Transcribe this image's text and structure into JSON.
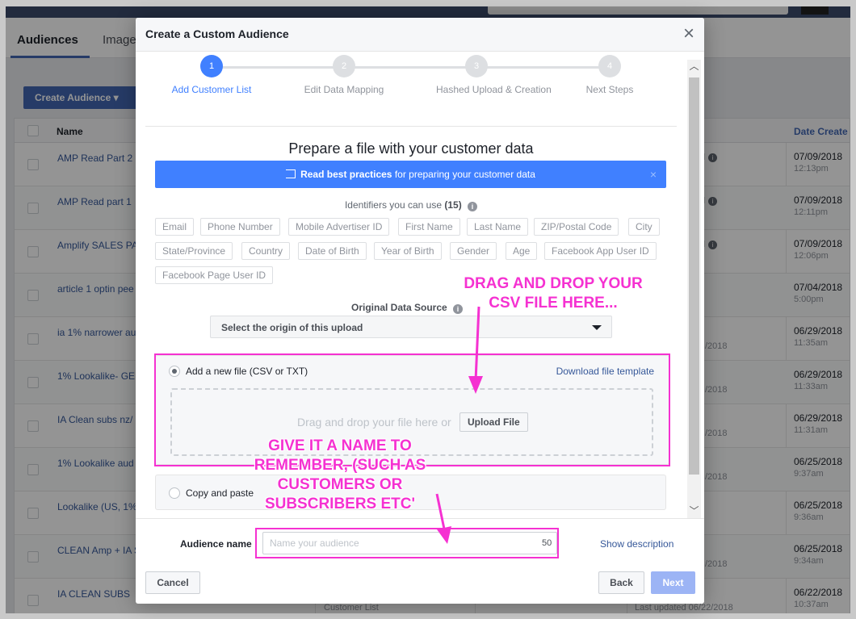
{
  "background": {
    "tabs": [
      "Audiences",
      "Image"
    ],
    "create_button": "Create Audience",
    "col_name": "Name",
    "col_date": "Date Create",
    "rows": [
      {
        "name": "AMP Read Part 2",
        "mid": "",
        "info": "ll",
        "date": "07/09/2018",
        "time": "12:13pm"
      },
      {
        "name": "AMP Read part 1",
        "mid": "",
        "info": "ll",
        "date": "07/09/2018",
        "time": "12:11pm"
      },
      {
        "name": "Amplify SALES PA",
        "mid": "",
        "info": "ll",
        "date": "07/09/2018",
        "time": "12:06pm"
      },
      {
        "name": "article 1 optin pee",
        "mid": "",
        "info": "",
        "date": "07/04/2018",
        "time": "5:00pm"
      },
      {
        "name": "ia 1% narrower au",
        "mid": "/2018",
        "info": "",
        "date": "06/29/2018",
        "time": "11:35am"
      },
      {
        "name": "1% Lookalike- GE",
        "mid": "/2018",
        "info": "",
        "date": "06/29/2018",
        "time": "11:33am"
      },
      {
        "name": "IA Clean subs nz/",
        "mid": "/2018",
        "info": "",
        "date": "06/29/2018",
        "time": "11:31am"
      },
      {
        "name": "1% Lookalike aud",
        "mid": "/2018",
        "info": "",
        "date": "06/25/2018",
        "time": "9:37am"
      },
      {
        "name": "Lookalike (US, 1%",
        "mid": "",
        "info": "",
        "date": "06/25/2018",
        "time": "9:36am"
      },
      {
        "name": "CLEAN Amp + IA S",
        "mid": "/2018",
        "info": "",
        "date": "06/25/2018",
        "time": "9:34am"
      },
      {
        "name": "IA CLEAN SUBS",
        "mid": "Last updated 06/22/2018",
        "info": "",
        "date": "06/22/2018",
        "time": "10:37am",
        "extra": "Customer List"
      }
    ]
  },
  "modal": {
    "title": "Create a Custom Audience",
    "close": "×",
    "steps": [
      {
        "num": "1",
        "label": "Add Customer List",
        "active": true
      },
      {
        "num": "2",
        "label": "Edit Data Mapping",
        "active": false
      },
      {
        "num": "3",
        "label": "Hashed Upload & Creation",
        "active": false
      },
      {
        "num": "4",
        "label": "Next Steps",
        "active": false
      }
    ],
    "heading": "Prepare a file with your customer data",
    "best_practices": {
      "bold": "Read best practices",
      "rest": " for preparing your customer data",
      "close": "×"
    },
    "identifiers_label": "Identifiers you can use",
    "identifiers_count": "(15)",
    "identifiers": [
      "Email",
      "Phone Number",
      "Mobile Advertiser ID",
      "First Name",
      "Last Name",
      "ZIP/Postal Code",
      "City",
      "State/Province",
      "Country",
      "Date of Birth",
      "Year of Birth",
      "Gender",
      "Age",
      "Facebook App User ID",
      "Facebook Page User ID"
    ],
    "origin_label": "Original Data Source",
    "origin_select": "Select the origin of this upload",
    "add_file_label": "Add a new file (CSV or TXT)",
    "download_template": "Download file template",
    "drop_text": "Drag and drop your file here or",
    "upload_button": "Upload File",
    "copy_paste_label": "Copy and paste",
    "audience_name_label": "Audience name",
    "audience_name_placeholder": "Name your audience",
    "audience_name_value": "",
    "char_limit": "50",
    "show_description": "Show description",
    "cancel": "Cancel",
    "back": "Back",
    "next": "Next"
  },
  "annotations": {
    "drag_drop": [
      "DRAG AND DROP YOUR",
      "CSV FILE HERE..."
    ],
    "give_name": [
      "GIVE IT A NAME TO",
      "REMEMBER, (SUCH AS",
      "CUSTOMERS OR",
      "SUBSCRIBERS ETC'"
    ],
    "color": "#f531d1"
  },
  "colors": {
    "accent": "#4080ff",
    "link": "#365899",
    "annotation": "#f531d1"
  }
}
